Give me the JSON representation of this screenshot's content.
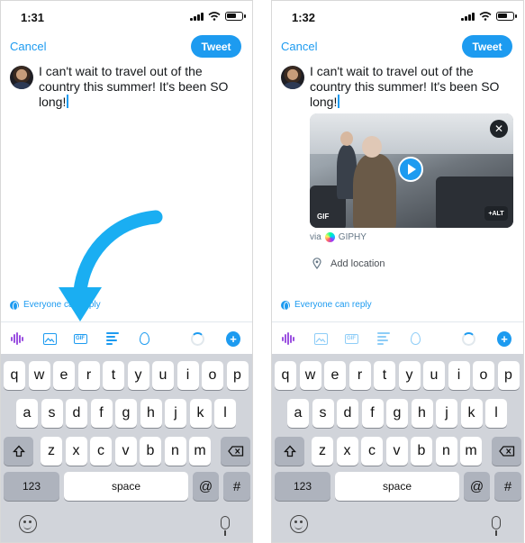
{
  "accent_color": "#1d9bf0",
  "arrow_color": "#1aaef2",
  "left": {
    "status_time": "1:31",
    "cancel_label": "Cancel",
    "tweet_label": "Tweet",
    "tweet_text": "I can't wait to travel out of the country this summer! It's been SO long!",
    "reply_setting": "Everyone can reply",
    "toolbar_gif_label": "GIF"
  },
  "right": {
    "status_time": "1:32",
    "cancel_label": "Cancel",
    "tweet_label": "Tweet",
    "tweet_text": "I can't wait to travel out of the country this summer! It's been SO long!",
    "media_gif_badge": "GIF",
    "media_alt_badge": "+ALT",
    "via_prefix": "via",
    "via_source": "GIPHY",
    "add_location": "Add location",
    "reply_setting": "Everyone can reply",
    "toolbar_gif_label": "GIF"
  },
  "keyboard": {
    "row1": [
      "q",
      "w",
      "e",
      "r",
      "t",
      "y",
      "u",
      "i",
      "o",
      "p"
    ],
    "row2": [
      "a",
      "s",
      "d",
      "f",
      "g",
      "h",
      "j",
      "k",
      "l"
    ],
    "row3": [
      "z",
      "x",
      "c",
      "v",
      "b",
      "n",
      "m"
    ],
    "numbers_label": "123",
    "space_label": "space",
    "at_label": "@",
    "hash_label": "#"
  },
  "icons": {
    "shift": "shift-icon",
    "backspace": "backspace-icon",
    "emoji": "emoji-icon",
    "mic": "microphone-icon",
    "arrow": "curved-arrow-annotation"
  }
}
